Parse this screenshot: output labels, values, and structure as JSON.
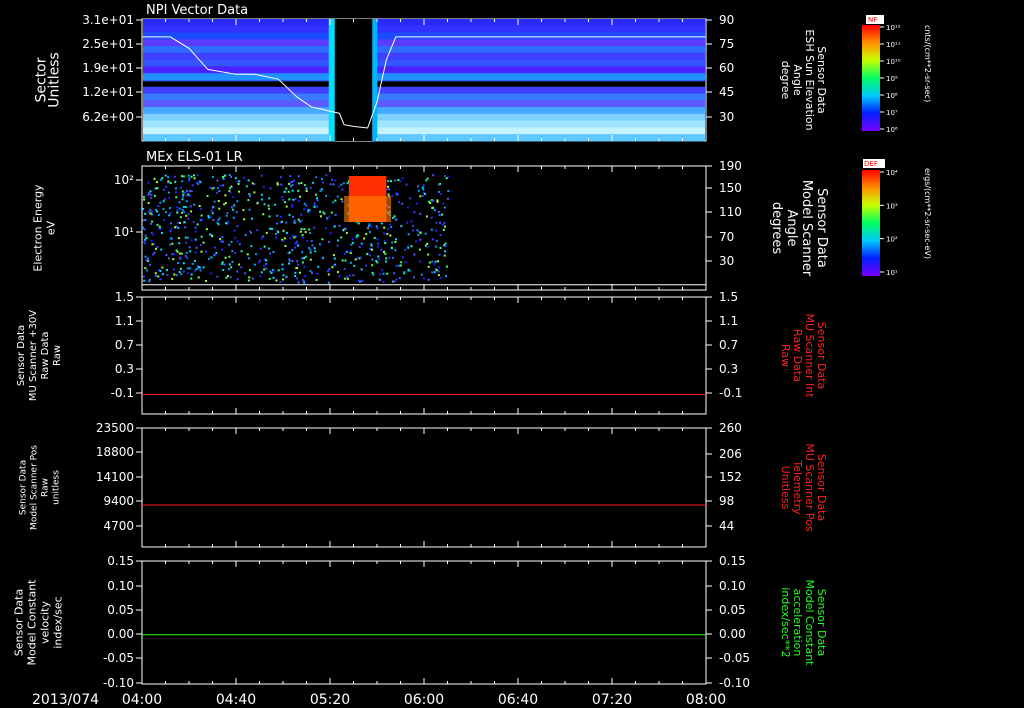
{
  "date_label": "2013/074",
  "time_labels": [
    "04:00",
    "04:40",
    "05:20",
    "06:00",
    "06:40",
    "07:20",
    "08:00"
  ],
  "colors": {
    "red": "#ff2020",
    "green": "#20ff20",
    "white": "#ffffff"
  },
  "colorbars": [
    {
      "tag": "NF",
      "unit": "cnts/(cm**2-sr-sec)",
      "ticks": [
        "10¹²",
        "10¹¹",
        "10¹⁰",
        "10⁹",
        "10⁸",
        "10⁷",
        "10⁶"
      ]
    },
    {
      "tag": "DEF",
      "unit": "ergs/(cm**2-sr-sec-eV)",
      "ticks": [
        "10⁴",
        "10³",
        "10²",
        "10¹"
      ]
    }
  ],
  "chart_data": [
    {
      "type": "heatmap",
      "title": "NPI Vector Data",
      "ylabel": [
        "Sector",
        "Unitless"
      ],
      "yticks": [
        "3.1e+01",
        "2.5e+01",
        "1.9e+01",
        "1.2e+01",
        "6.2e+00"
      ],
      "y2label": [
        "Sensor Data",
        "ESH Sun Elevation",
        "Angle",
        "degree"
      ],
      "y2ticks": [
        "90",
        "75",
        "60",
        "45",
        "30"
      ],
      "y2lim": [
        15,
        90
      ],
      "overlay_line": {
        "name": "ESH Sun Elevation Angle",
        "x_min_since_0400": [
          0,
          12,
          20,
          28,
          40,
          48,
          58,
          66,
          72,
          78,
          84,
          86,
          90,
          96,
          100,
          104,
          108,
          240
        ],
        "y_deg": [
          79,
          79,
          72,
          59,
          56,
          56,
          53,
          42,
          36,
          34,
          32,
          25,
          24,
          23,
          39,
          65,
          79,
          79
        ]
      },
      "data_gap_min_since_0400": [
        82,
        98
      ]
    },
    {
      "type": "heatmap",
      "title": "MEx ELS-01 LR",
      "ylabel": [
        "Electron Energy",
        "eV"
      ],
      "yticks": [
        "10²",
        "10¹"
      ],
      "y2label": [
        "Sensor Data",
        "Model Scanner",
        "Angle",
        "degrees"
      ],
      "y2ticks": [
        "190",
        "150",
        "110",
        "70",
        "30"
      ],
      "y2lim": [
        0,
        190
      ],
      "overlay_line": {
        "name": "Model Scanner Angle",
        "value_deg": 8
      },
      "data_extent_min_since_0400": [
        0,
        130
      ]
    },
    {
      "type": "line",
      "ylabel": [
        "Sensor Data",
        "MU Scanner +30V",
        "Raw Data",
        "Raw"
      ],
      "yticks": [
        "1.5",
        "1.1",
        "0.7",
        "0.3",
        "-0.1"
      ],
      "ylim": [
        -0.3,
        1.5
      ],
      "y2label": [
        "Sensor Data",
        "MU Scanner Int",
        "Raw Data",
        "Raw"
      ],
      "y2ticks": [
        "1.5",
        "1.1",
        "0.7",
        "0.3",
        "-0.1"
      ],
      "series": [
        {
          "x": [
            0,
            240
          ],
          "y": [
            0.0,
            0.0
          ]
        }
      ]
    },
    {
      "type": "line",
      "ylabel": [
        "Sensor Data",
        "Model Scanner Pos",
        "Raw",
        "unitless"
      ],
      "yticks": [
        "23500",
        "18800",
        "14100",
        "9400",
        "4700"
      ],
      "ylim": [
        0,
        23500
      ],
      "y2label": [
        "Sensor Data",
        "MU Scanner Pos",
        "Telemetry",
        "Unitless"
      ],
      "y2ticks": [
        "260",
        "206",
        "152",
        "98",
        "44"
      ],
      "series": [
        {
          "x": [
            0,
            240
          ],
          "y": [
            8300,
            8300
          ]
        }
      ]
    },
    {
      "type": "line",
      "ylabel": [
        "Sensor Data",
        "Model Constant",
        "velocity",
        "index/sec"
      ],
      "yticks": [
        "0.15",
        "0.10",
        "0.05",
        "0.00",
        "-0.05",
        "-0.10"
      ],
      "ylim": [
        -0.1,
        0.15
      ],
      "y2label": [
        "Sensor Data",
        "Model Constant",
        "acceleration",
        "index/sec**2"
      ],
      "y2ticks": [
        "0.15",
        "0.10",
        "0.05",
        "0.00",
        "-0.05",
        "-0.10"
      ],
      "series": [
        {
          "x": [
            0,
            240
          ],
          "y": [
            0.0,
            0.0
          ]
        }
      ]
    }
  ]
}
